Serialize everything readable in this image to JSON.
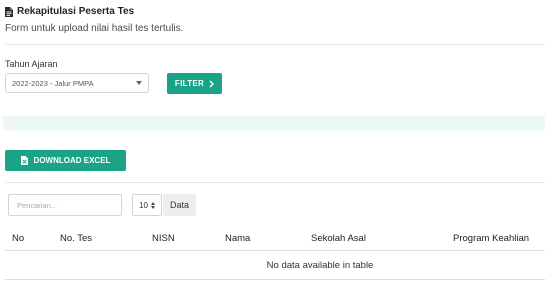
{
  "header": {
    "icon": "file-icon",
    "title": "Rekapitulasi Peserta Tes",
    "subtitle": "Form untuk upload nilai hasil tes tertulis."
  },
  "filter": {
    "label": "Tahun Ajaran",
    "selected": "2022-2023 - Jalur PMPA",
    "button_label": "FILTER"
  },
  "download": {
    "label": "DOWNLOAD EXCEL",
    "icon": "excel-file-icon"
  },
  "table_controls": {
    "search_placeholder": "Pencarian...",
    "page_length": "10",
    "page_length_suffix": "Data"
  },
  "table": {
    "columns": [
      "No",
      "No. Tes",
      "NISN",
      "Nama",
      "Sekolah Asal",
      "Program Keahlian"
    ],
    "empty_message": "No data available in table"
  },
  "colors": {
    "accent": "#1aa387",
    "info_band": "#eef8f4"
  }
}
